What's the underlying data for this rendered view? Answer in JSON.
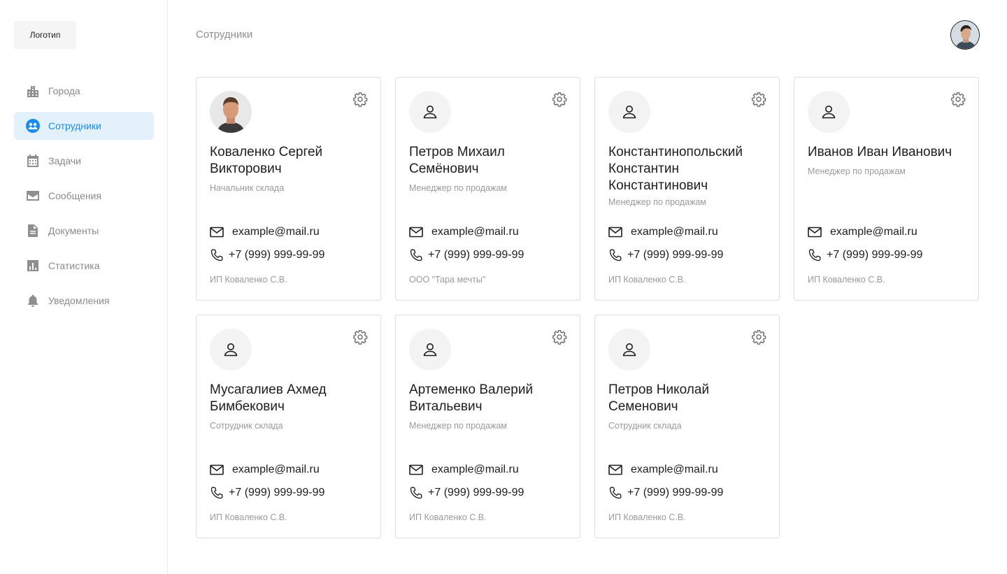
{
  "logo": {
    "label": "Логотип"
  },
  "sidebar": {
    "items": [
      {
        "label": "Города",
        "icon": "city-icon",
        "active": false
      },
      {
        "label": "Сотрудники",
        "icon": "employees-icon",
        "active": true
      },
      {
        "label": "Задачи",
        "icon": "calendar-icon",
        "active": false
      },
      {
        "label": "Сообщения",
        "icon": "mail-icon",
        "active": false
      },
      {
        "label": "Документы",
        "icon": "document-icon",
        "active": false
      },
      {
        "label": "Статистика",
        "icon": "chart-icon",
        "active": false
      },
      {
        "label": "Уведомления",
        "icon": "bell-icon",
        "active": false
      }
    ],
    "active_color": "#1a8cf0",
    "active_bg": "#e3f1fd"
  },
  "header": {
    "title": "Сотрудники",
    "avatar_icon": "user-avatar-photo"
  },
  "employees": [
    {
      "name": "Коваленко Сергей Викторович",
      "role": "Начальник склада",
      "email": "example@mail.ru",
      "phone": "+7 (999) 999-99-99",
      "company": "ИП Коваленко С.В.",
      "photo": true
    },
    {
      "name": "Петров Михаил Семёнович",
      "role": "Менеджер по продажам",
      "email": "example@mail.ru",
      "phone": "+7 (999) 999-99-99",
      "company": "ООО \"Тара мечты\"",
      "photo": false
    },
    {
      "name": "Константинопольский Константин Константинович",
      "role": "Менеджер по продажам",
      "email": "example@mail.ru",
      "phone": "+7 (999) 999-99-99",
      "company": "ИП Коваленко С.В.",
      "photo": false
    },
    {
      "name": "Иванов Иван Иванович",
      "role": "Менеджер по продажам",
      "email": "example@mail.ru",
      "phone": "+7 (999) 999-99-99",
      "company": "ИП Коваленко С.В.",
      "photo": false
    },
    {
      "name": "Мусагалиев Ахмед Бимбекович",
      "role": "Сотрудник склада",
      "email": "example@mail.ru",
      "phone": "+7 (999) 999-99-99",
      "company": "ИП Коваленко С.В.",
      "photo": false
    },
    {
      "name": "Артеменко Валерий Витальевич",
      "role": "Менеджер по продажам",
      "email": "example@mail.ru",
      "phone": "+7 (999) 999-99-99",
      "company": "ИП Коваленко С.В.",
      "photo": false
    },
    {
      "name": "Петров Николай Семенович",
      "role": "Сотрудник склада",
      "email": "example@mail.ru",
      "phone": "+7 (999) 999-99-99",
      "company": "ИП Коваленко С.В.",
      "photo": false
    }
  ]
}
